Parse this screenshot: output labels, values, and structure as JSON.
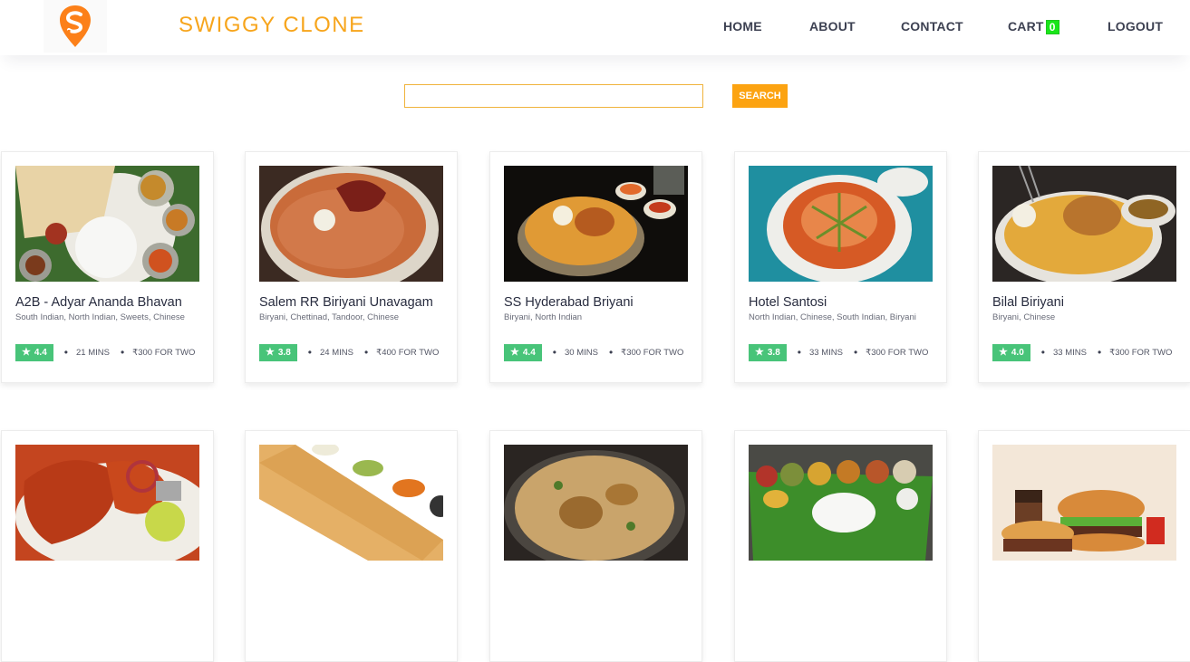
{
  "header": {
    "brand": "SWIGGY CLONE",
    "nav": [
      "HOME",
      "ABOUT",
      "CONTACT",
      "CART",
      "LOGOUT"
    ],
    "cart_count": "0",
    "logo_icon": "swiggy-logo-icon",
    "brand_color": "#f7a51c"
  },
  "search": {
    "value": "",
    "placeholder": "",
    "button": "SEARCH"
  },
  "restaurants": [
    {
      "name": "A2B - Adyar Ananda Bhavan",
      "cuisine": "South Indian, North Indian, Sweets, Chinese",
      "rating": "4.4",
      "time": "21 MINS",
      "cost": "₹300 FOR TWO",
      "image": "thali-dosa-image"
    },
    {
      "name": "Salem RR Biriyani Unavagam",
      "cuisine": "Biryani, Chettinad, Tandoor, Chinese",
      "rating": "3.8",
      "time": "24 MINS",
      "cost": "₹400 FOR TWO",
      "image": "biryani-plate-image"
    },
    {
      "name": "SS Hyderabad Briyani",
      "cuisine": "Biryani, North Indian",
      "rating": "4.4",
      "time": "30 MINS",
      "cost": "₹300 FOR TWO",
      "image": "biryani-bowl-image"
    },
    {
      "name": "Hotel Santosi",
      "cuisine": "North Indian, Chinese, South Indian, Biryani",
      "rating": "3.8",
      "time": "33 MINS",
      "cost": "₹300 FOR TWO",
      "image": "curry-bowl-image"
    },
    {
      "name": "Bilal Biriyani",
      "cuisine": "Biryani, Chinese",
      "rating": "4.0",
      "time": "33 MINS",
      "cost": "₹300 FOR TWO",
      "image": "chicken-biryani-image"
    },
    {
      "name": "",
      "cuisine": "",
      "rating": "",
      "time": "",
      "cost": "",
      "image": "tandoori-chicken-image"
    },
    {
      "name": "",
      "cuisine": "",
      "rating": "",
      "time": "",
      "cost": "",
      "image": "dosa-chutney-image"
    },
    {
      "name": "",
      "cuisine": "",
      "rating": "",
      "time": "",
      "cost": "",
      "image": "biryani-top-view-image"
    },
    {
      "name": "",
      "cuisine": "",
      "rating": "",
      "time": "",
      "cost": "",
      "image": "banana-leaf-meal-image"
    },
    {
      "name": "",
      "cuisine": "",
      "rating": "",
      "time": "",
      "cost": "",
      "image": "burger-combo-image"
    }
  ]
}
